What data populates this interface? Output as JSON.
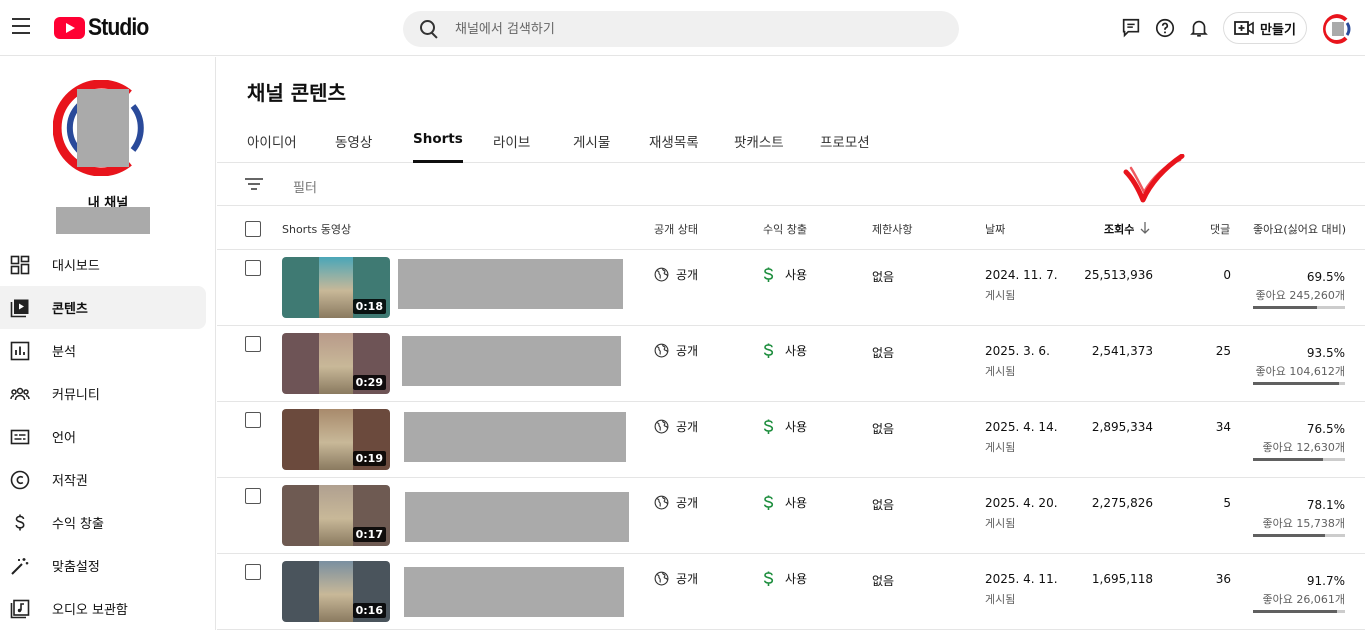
{
  "app": {
    "logo_text": "Studio",
    "brand_red": "#ff0033"
  },
  "search": {
    "placeholder": "채널에서 검색하기"
  },
  "header": {
    "create_label": "만들기"
  },
  "channel": {
    "label": "내 채널"
  },
  "sidebar": {
    "items": [
      {
        "label": "대시보드",
        "icon": "dashboard-icon"
      },
      {
        "label": "콘텐츠",
        "icon": "content-icon",
        "active": true
      },
      {
        "label": "분석",
        "icon": "analytics-icon"
      },
      {
        "label": "커뮤니티",
        "icon": "community-icon"
      },
      {
        "label": "언어",
        "icon": "subtitles-icon"
      },
      {
        "label": "저작권",
        "icon": "copyright-icon"
      },
      {
        "label": "수익 창출",
        "icon": "dollar-icon"
      },
      {
        "label": "맞춤설정",
        "icon": "magic-wand-icon"
      },
      {
        "label": "오디오 보관함",
        "icon": "audio-library-icon"
      }
    ]
  },
  "main": {
    "title": "채널 콘텐츠",
    "tabs": [
      {
        "label": "아이디어"
      },
      {
        "label": "동영상"
      },
      {
        "label": "Shorts",
        "active": true
      },
      {
        "label": "라이브"
      },
      {
        "label": "게시물"
      },
      {
        "label": "재생목록"
      },
      {
        "label": "팟캐스트"
      },
      {
        "label": "프로모션"
      }
    ],
    "filter_label": "필터"
  },
  "table": {
    "headers": {
      "video": "Shorts 동영상",
      "visibility": "공개 상태",
      "monetization": "수익 창출",
      "restrictions": "제한사항",
      "date": "날짜",
      "views": "조회수",
      "comments": "댓글",
      "likes": "좋아요(싫어요 대비)"
    },
    "rows": [
      {
        "duration": "0:18",
        "visibility": "공개",
        "monetization": "사용",
        "restrictions": "없음",
        "date": "2024. 11. 7.",
        "date_status": "게시됨",
        "views": "25,513,936",
        "comments": "0",
        "likes_pct": "69.5%",
        "likes_count": "좋아요 245,260개",
        "likes_ratio": 0.695,
        "thumb_bg": "#3f7a73",
        "thumb_fg": "#4aa6b8"
      },
      {
        "duration": "0:29",
        "visibility": "공개",
        "monetization": "사용",
        "restrictions": "없음",
        "date": "2025. 3. 6.",
        "date_status": "게시됨",
        "views": "2,541,373",
        "comments": "25",
        "likes_pct": "93.5%",
        "likes_count": "좋아요 104,612개",
        "likes_ratio": 0.935,
        "thumb_bg": "#6e5456",
        "thumb_fg": "#b89a8a"
      },
      {
        "duration": "0:19",
        "visibility": "공개",
        "monetization": "사용",
        "restrictions": "없음",
        "date": "2025. 4. 14.",
        "date_status": "게시됨",
        "views": "2,895,334",
        "comments": "34",
        "likes_pct": "76.5%",
        "likes_count": "좋아요 12,630개",
        "likes_ratio": 0.765,
        "thumb_bg": "#6b4a3d",
        "thumb_fg": "#a88a6c"
      },
      {
        "duration": "0:17",
        "visibility": "공개",
        "monetization": "사용",
        "restrictions": "없음",
        "date": "2025. 4. 20.",
        "date_status": "게시됨",
        "views": "2,275,826",
        "comments": "5",
        "likes_pct": "78.1%",
        "likes_count": "좋아요 15,738개",
        "likes_ratio": 0.781,
        "thumb_bg": "#6e5a52",
        "thumb_fg": "#b0a090"
      },
      {
        "duration": "0:16",
        "visibility": "공개",
        "monetization": "사용",
        "restrictions": "없음",
        "date": "2025. 4. 11.",
        "date_status": "게시됨",
        "views": "1,695,118",
        "comments": "36",
        "likes_pct": "91.7%",
        "likes_count": "좋아요 26,061개",
        "likes_ratio": 0.917,
        "thumb_bg": "#4a545c",
        "thumb_fg": "#7a8fa0"
      }
    ]
  },
  "colors": {
    "money_green": "#1e8e3e",
    "annotation_red": "#e8141c"
  }
}
